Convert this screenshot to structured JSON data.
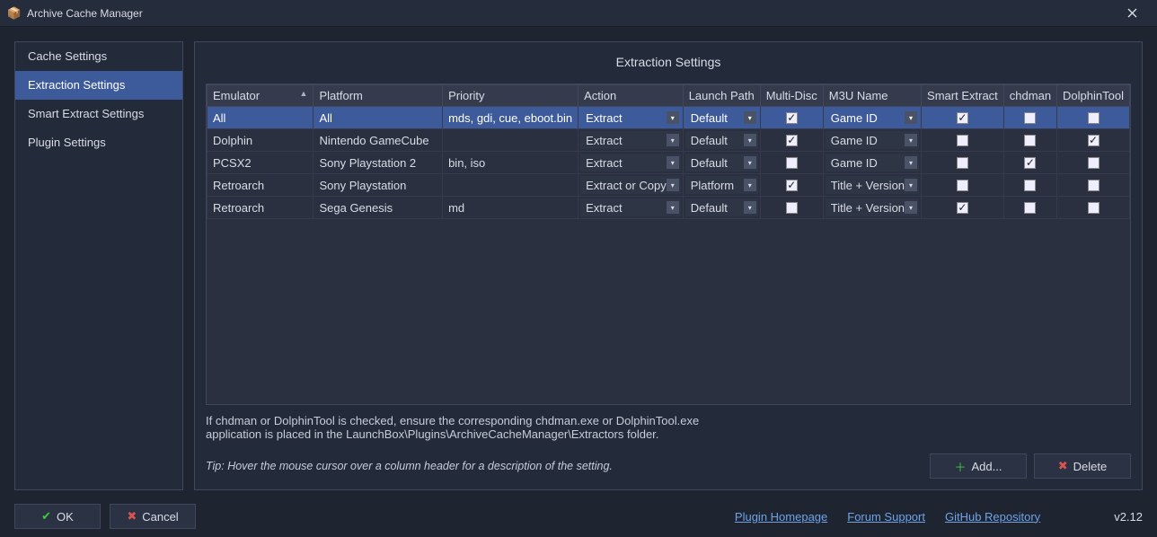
{
  "window": {
    "title": "Archive Cache Manager"
  },
  "sidebar": {
    "items": [
      {
        "label": "Cache Settings"
      },
      {
        "label": "Extraction Settings"
      },
      {
        "label": "Smart Extract Settings"
      },
      {
        "label": "Plugin Settings"
      }
    ]
  },
  "panel": {
    "title": "Extraction Settings"
  },
  "table": {
    "columns": {
      "emulator": "Emulator",
      "platform": "Platform",
      "priority": "Priority",
      "action": "Action",
      "launch_path": "Launch Path",
      "multi_disc": "Multi-Disc",
      "m3u_name": "M3U Name",
      "smart_extract": "Smart Extract",
      "chdman": "chdman",
      "dolphin_tool": "DolphinTool"
    },
    "rows": [
      {
        "emulator": "All",
        "platform": "All",
        "priority": "mds, gdi, cue, eboot.bin",
        "action": "Extract",
        "launch_path": "Default",
        "multi_disc": true,
        "m3u_name": "Game ID",
        "smart_extract": true,
        "chdman": false,
        "dolphin_tool": false,
        "selected": true
      },
      {
        "emulator": "Dolphin",
        "platform": "Nintendo GameCube",
        "priority": "",
        "action": "Extract",
        "launch_path": "Default",
        "multi_disc": true,
        "m3u_name": "Game ID",
        "smart_extract": false,
        "chdman": false,
        "dolphin_tool": true,
        "selected": false
      },
      {
        "emulator": "PCSX2",
        "platform": "Sony Playstation 2",
        "priority": "bin, iso",
        "action": "Extract",
        "launch_path": "Default",
        "multi_disc": false,
        "m3u_name": "Game ID",
        "smart_extract": false,
        "chdman": true,
        "dolphin_tool": false,
        "selected": false
      },
      {
        "emulator": "Retroarch",
        "platform": "Sony Playstation",
        "priority": "",
        "action": "Extract or Copy",
        "launch_path": "Platform",
        "multi_disc": true,
        "m3u_name": "Title + Version",
        "smart_extract": false,
        "chdman": false,
        "dolphin_tool": false,
        "selected": false
      },
      {
        "emulator": "Retroarch",
        "platform": "Sega Genesis",
        "priority": "md",
        "action": "Extract",
        "launch_path": "Default",
        "multi_disc": false,
        "m3u_name": "Title + Version",
        "smart_extract": true,
        "chdman": false,
        "dolphin_tool": false,
        "selected": false
      }
    ]
  },
  "help": {
    "line1": "If chdman or DolphinTool is checked, ensure the corresponding chdman.exe or DolphinTool.exe",
    "line2": "application is placed in the LaunchBox\\Plugins\\ArchiveCacheManager\\Extractors folder.",
    "tip": "Tip: Hover the mouse cursor over a column header for a description of the setting."
  },
  "buttons": {
    "add": "Add...",
    "delete": "Delete",
    "ok": "OK",
    "cancel": "Cancel"
  },
  "links": {
    "plugin": "Plugin Homepage",
    "forum": "Forum Support",
    "github": "GitHub Repository"
  },
  "version": "v2.12"
}
